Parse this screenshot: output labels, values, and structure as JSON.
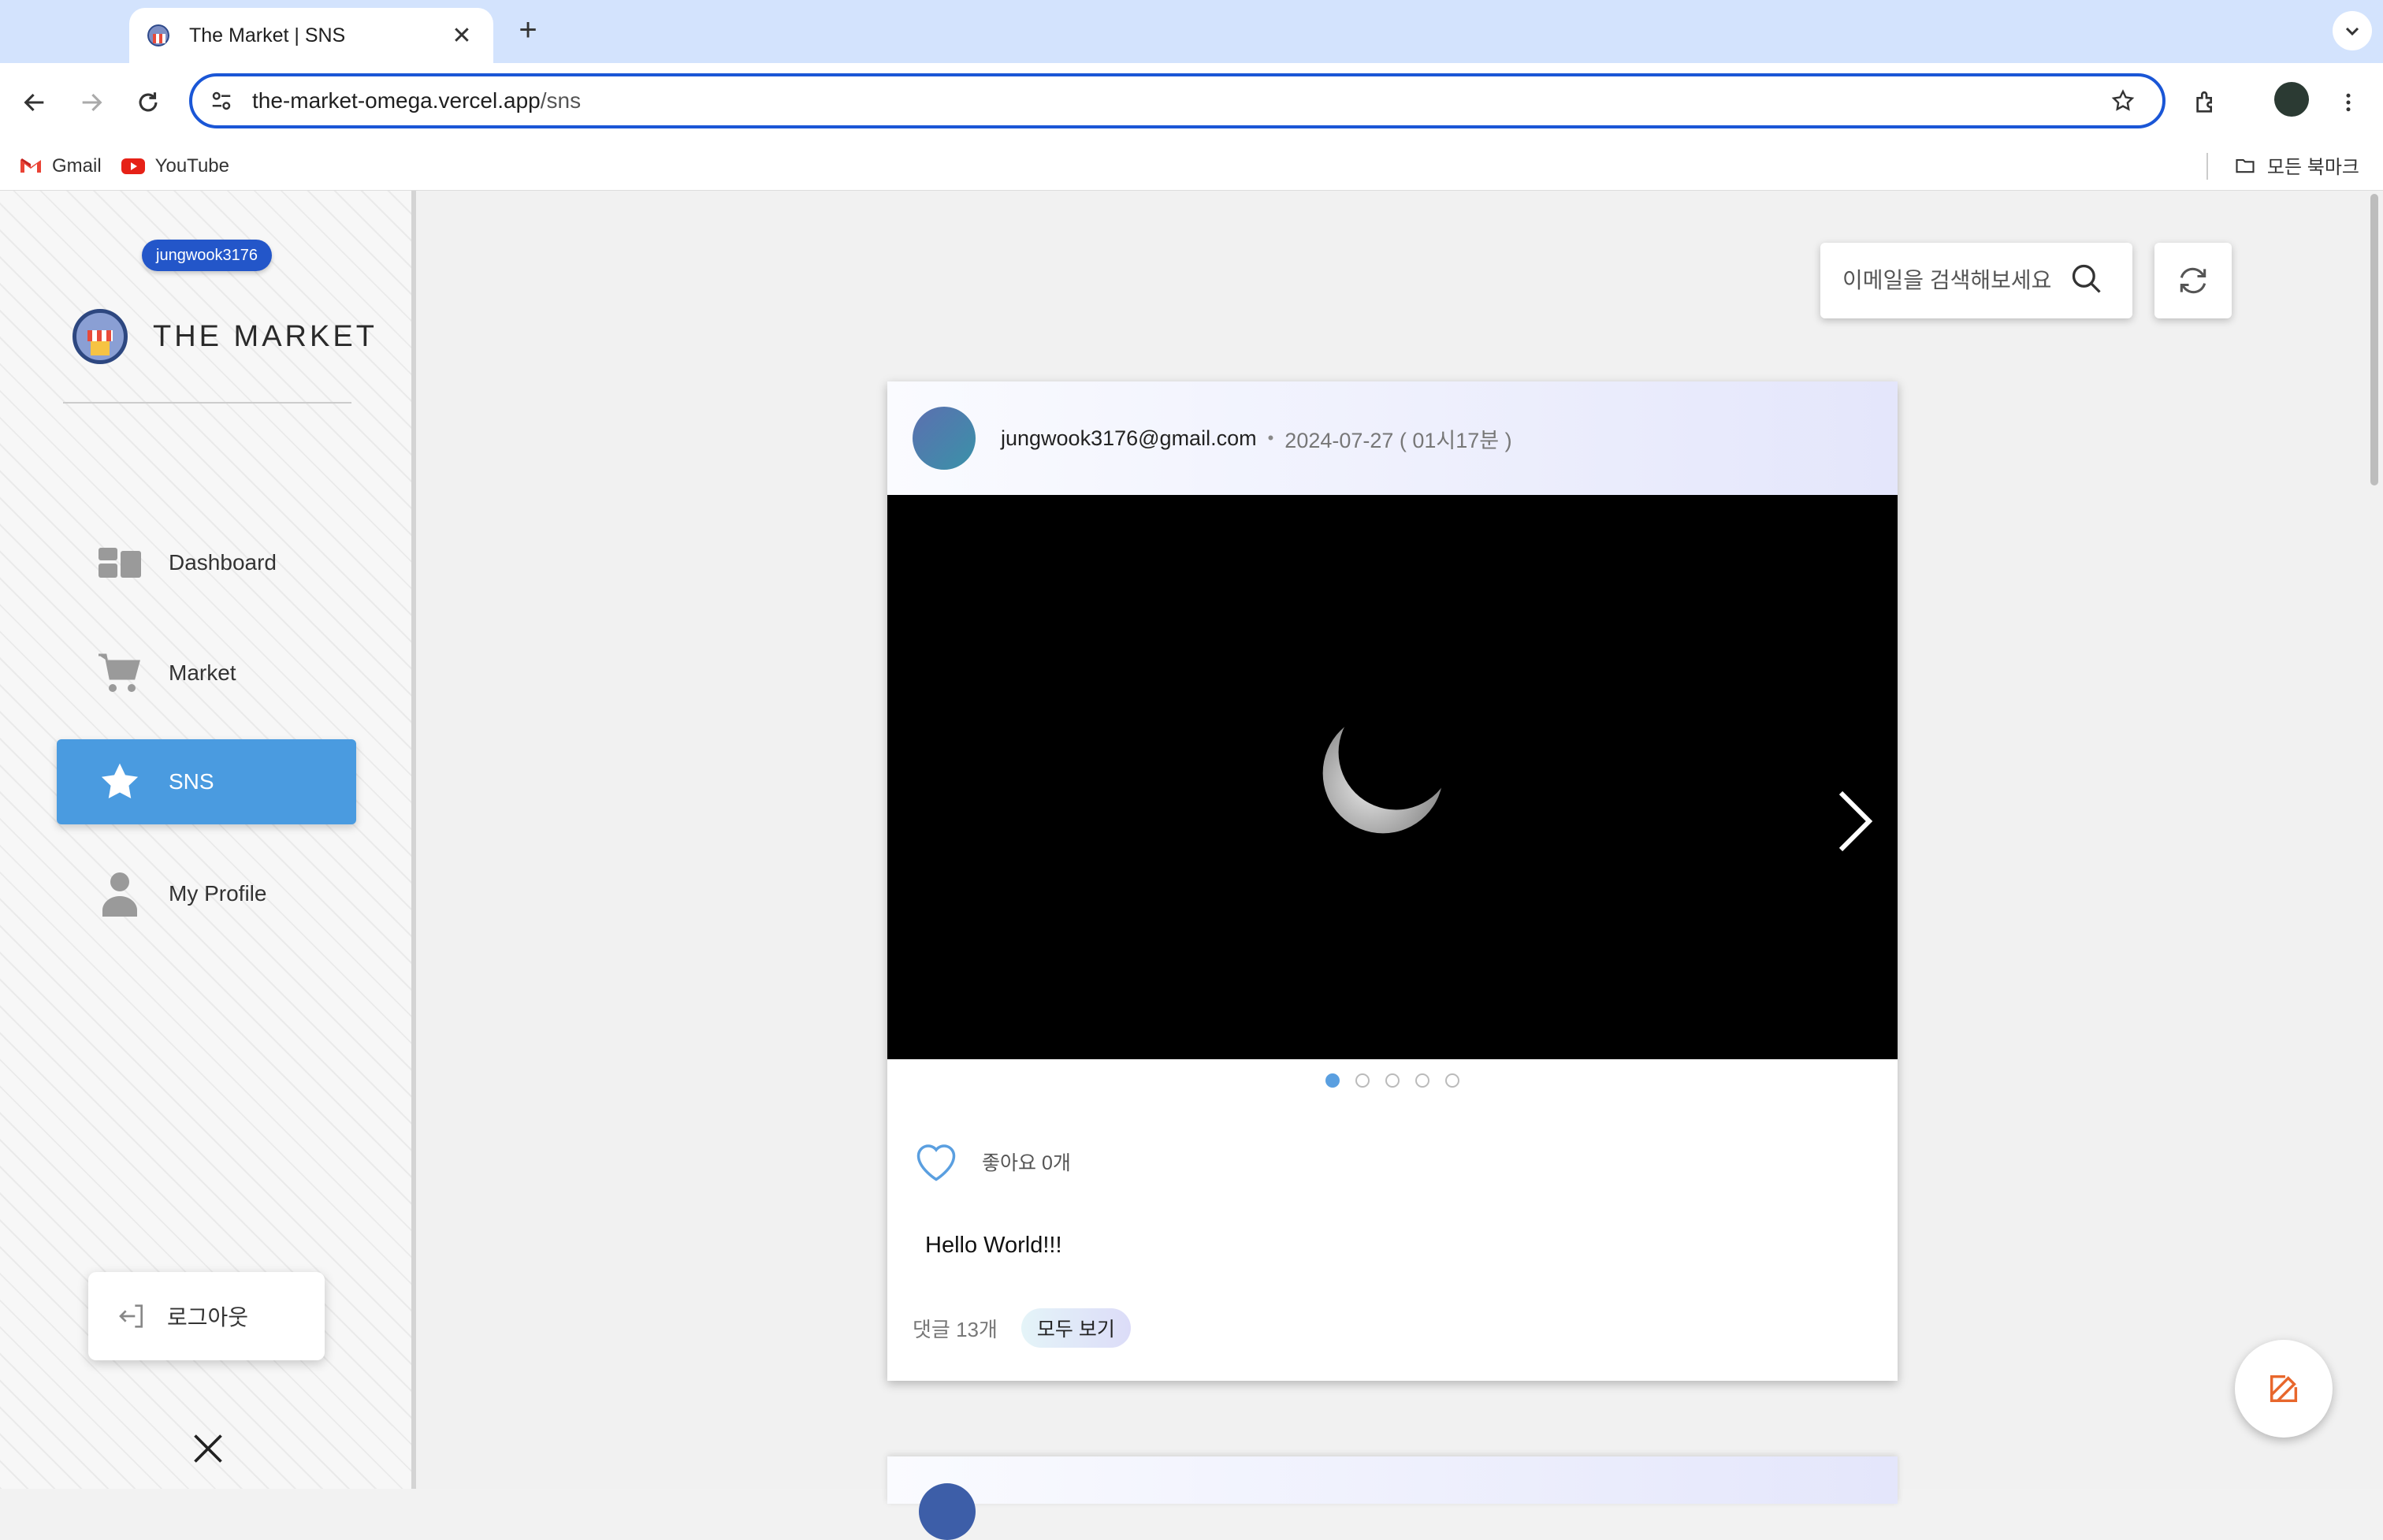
{
  "browser": {
    "tab_title": "The Market | SNS",
    "url_host": "the-market-omega.vercel.app",
    "url_path": "/sns",
    "bookmarks": [
      {
        "label": "Gmail",
        "icon": "gmail-icon"
      },
      {
        "label": "YouTube",
        "icon": "youtube-icon"
      }
    ],
    "all_bookmarks_label": "모든 북마크"
  },
  "sidebar": {
    "username": "jungwook3176",
    "brand": "THE MARKET",
    "items": [
      {
        "label": "Dashboard",
        "icon": "dashboard-icon",
        "active": false
      },
      {
        "label": "Market",
        "icon": "cart-icon",
        "active": false
      },
      {
        "label": "SNS",
        "icon": "star-icon",
        "active": true
      },
      {
        "label": "My Profile",
        "icon": "person-icon",
        "active": false
      }
    ],
    "logout_label": "로그아웃"
  },
  "search": {
    "placeholder": "이메일을 검색해보세요"
  },
  "post": {
    "author": "jungwook3176@gmail.com",
    "separator": "•",
    "date": "2024-07-27 ( 01시17분 )",
    "image_count": 5,
    "current_image": 1,
    "likes_label": "좋아요 0개",
    "content": "Hello World!!!",
    "comments_label": "댓글 13개",
    "view_all_label": "모두 보기"
  },
  "colors": {
    "accent": "#4a9be0",
    "user_pill": "#2356c9",
    "omnibox_border": "#1a56d6",
    "tabstrip": "#d3e3fd",
    "fab_icon": "#e8672c"
  }
}
